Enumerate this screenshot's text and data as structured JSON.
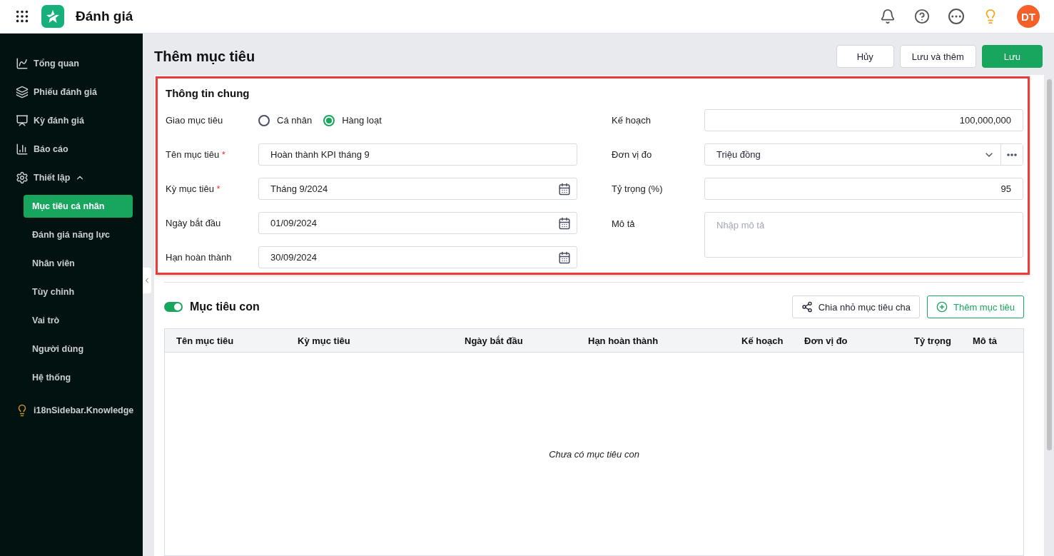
{
  "app": {
    "title": "Đánh giá",
    "avatar": "DT"
  },
  "sidebar": {
    "items": [
      {
        "label": "Tổng quan",
        "selected": false
      },
      {
        "label": "Phiếu đánh giá",
        "selected": false
      },
      {
        "label": "Kỳ đánh giá",
        "selected": false
      },
      {
        "label": "Báo cáo",
        "selected": false
      },
      {
        "label": "Thiết lập",
        "selected": false,
        "expanded": true,
        "children": [
          {
            "label": "Mục tiêu cá nhân",
            "selected": true
          },
          {
            "label": "Đánh giá năng lực",
            "selected": false
          },
          {
            "label": "Nhân viên",
            "selected": false
          },
          {
            "label": "Tùy chỉnh",
            "selected": false
          },
          {
            "label": "Vai trò",
            "selected": false
          },
          {
            "label": "Người dùng",
            "selected": false
          },
          {
            "label": "Hệ thống",
            "selected": false
          }
        ]
      },
      {
        "label": "i18nSidebar.Knowledge",
        "selected": false
      }
    ]
  },
  "page": {
    "title": "Thêm mục tiêu",
    "actions": [
      {
        "label": "Hủy",
        "kind": "secondary"
      },
      {
        "label": "Lưu và thêm",
        "kind": "secondary"
      },
      {
        "label": "Lưu",
        "kind": "primary"
      }
    ]
  },
  "general": {
    "title": "Thông tin chung",
    "highlighted": true,
    "assign": {
      "label": "Giao mục tiêu",
      "options": [
        {
          "label": "Cá nhân",
          "selected": false
        },
        {
          "label": "Hàng loạt",
          "selected": true
        }
      ]
    },
    "left_fields": [
      {
        "label": "Tên mục tiêu",
        "required_mark": "*",
        "kind": "text",
        "value": "Hoàn thành KPI tháng 9"
      },
      {
        "label": "Kỳ mục tiêu",
        "required_mark": "*",
        "kind": "date",
        "value": "Tháng 9/2024"
      },
      {
        "label": "Ngày bắt đầu",
        "kind": "date",
        "value": "01/09/2024"
      },
      {
        "label": "Hạn hoàn thành",
        "kind": "date",
        "value": "30/09/2024"
      }
    ],
    "right_fields": [
      {
        "label": "Kế hoạch",
        "kind": "number",
        "value": "100,000,000"
      },
      {
        "label": "Đơn vị đo",
        "kind": "select",
        "value": "Triệu đồng"
      },
      {
        "label": "Tỷ trọng (%)",
        "kind": "number",
        "value": "95"
      },
      {
        "label": "Mô tả",
        "kind": "textarea",
        "placeholder": "Nhập mô tả"
      }
    ]
  },
  "subgoals": {
    "title": "Mục tiêu con",
    "enabled": true,
    "actions": [
      {
        "label": "Chia nhỏ mục tiêu cha",
        "kind": "split"
      },
      {
        "label": "Thêm mục tiêu",
        "kind": "add"
      }
    ],
    "columns": [
      "Tên mục tiêu",
      "Kỳ mục tiêu",
      "Ngày bắt đầu",
      "Hạn hoàn thành",
      "Kế hoạch",
      "Đơn vị đo",
      "Tỷ trọng",
      "Mô tả"
    ],
    "empty_text": "Chưa có mục tiêu con"
  }
}
